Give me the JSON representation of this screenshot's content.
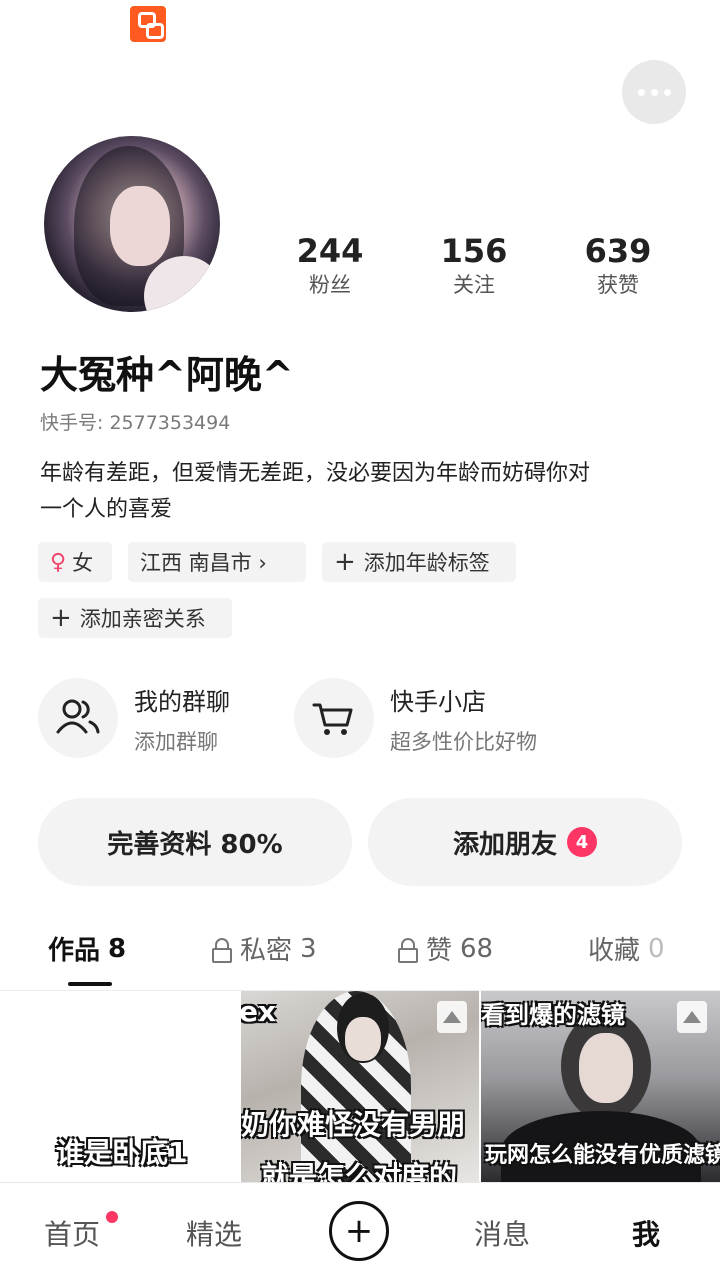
{
  "profile": {
    "nickname": "大冤种^阿晚^",
    "uid": "快手号: 2577353494",
    "bio_line1": "年龄有差距，但爱情无差距，没必要因为年龄而妨碍你对",
    "bio_line2": "一个人的喜爱",
    "stats": [
      {
        "value": "244",
        "label": "粉丝"
      },
      {
        "value": "156",
        "label": "关注"
      },
      {
        "value": "639",
        "label": "获赞"
      }
    ]
  },
  "tags": {
    "gender_symbol": "♀",
    "gender": "女",
    "location": "江西 南昌市 ›",
    "add_age": "添加年龄标签",
    "add_relation": "添加亲密关系",
    "plus": "+"
  },
  "features": {
    "group_title": "我的群聊",
    "group_sub": "添加群聊",
    "shop_title": "快手小店",
    "shop_sub": "超多性价比好物"
  },
  "actions": {
    "complete_profile": "完善资料 80%",
    "add_friends": "添加朋友",
    "add_friends_badge": "4"
  },
  "tabs": [
    {
      "label": "作品",
      "count": "8"
    },
    {
      "label": "私密",
      "count": "3"
    },
    {
      "label": "赞",
      "count": "68"
    },
    {
      "label": "收藏",
      "count": "0"
    }
  ],
  "grid": {
    "cell1_caption": "谁是卧底1",
    "cell2_caption_top": "ex",
    "cell2_caption_mid": "奶你难怪没有男朋",
    "cell2_caption_bot": "就是怎么对度的",
    "cell3_caption_top": "看到爆的滤镜",
    "cell3_caption_bot": "玩网怎么能没有优质滤镜"
  },
  "nav": {
    "home": "首页",
    "featured": "精选",
    "create": "+",
    "messages": "消息",
    "me": "我"
  },
  "icons": [
    "app-logo-icon",
    "more-icon",
    "group-icon",
    "cart-icon",
    "lock-icon",
    "image-icon",
    "plus-icon"
  ],
  "colors": {
    "accent": "#fe3666",
    "brand": "#ff5a1f"
  }
}
